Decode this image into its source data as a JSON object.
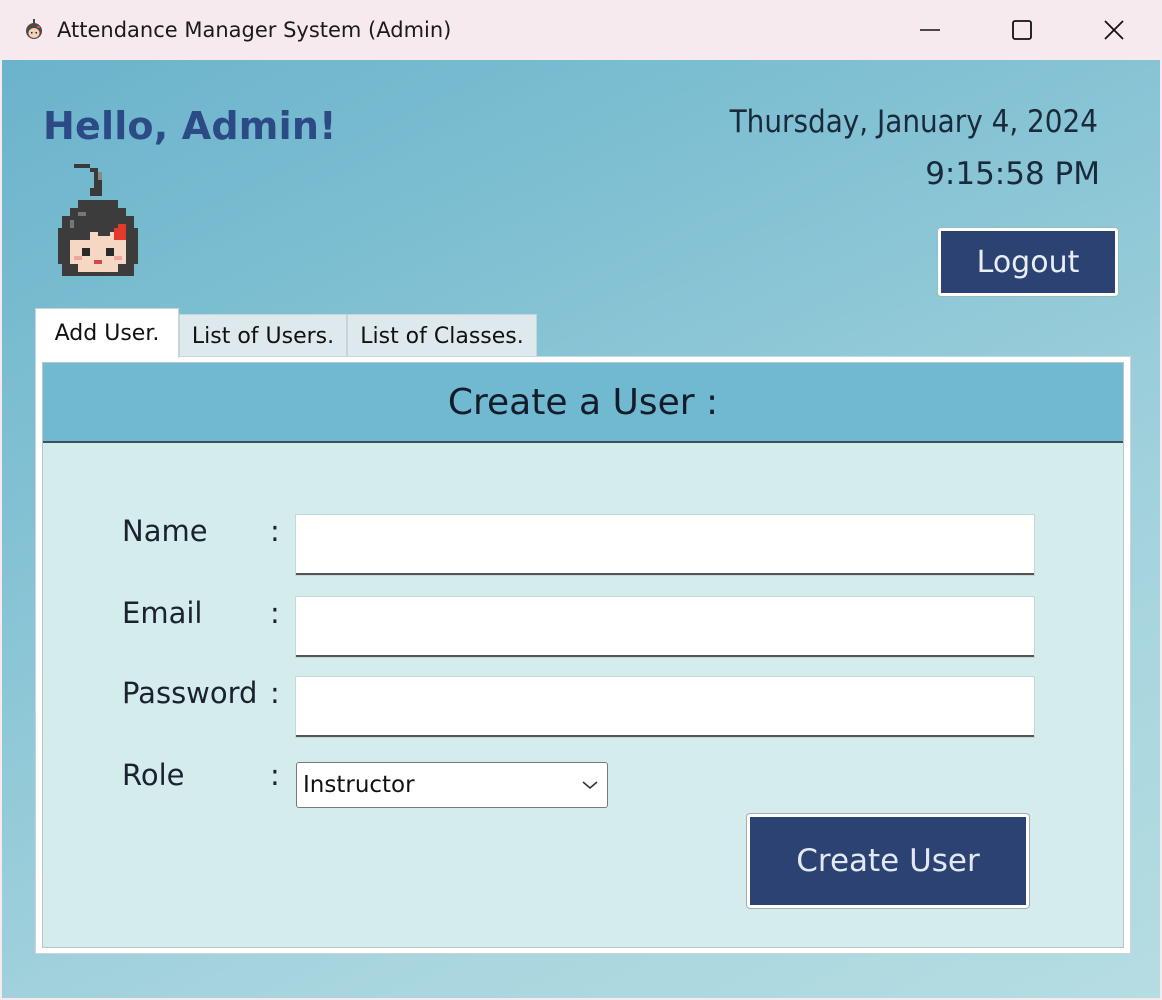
{
  "window": {
    "title": "Attendance Manager System (Admin)"
  },
  "header": {
    "greeting": "Hello, Admin!",
    "date": "Thursday, January 4, 2024",
    "time": "9:15:58 PM",
    "logout_label": "Logout"
  },
  "tabs": [
    {
      "label": "Add User.",
      "active": true
    },
    {
      "label": "List of Users.",
      "active": false
    },
    {
      "label": "List of Classes.",
      "active": false
    }
  ],
  "form": {
    "heading": "Create a User :",
    "name_label": "Name",
    "email_label": "Email",
    "password_label": "Password",
    "role_label": "Role",
    "colon": ":",
    "name_value": "",
    "email_value": "",
    "password_value": "",
    "role_value": "Instructor",
    "submit_label": "Create User"
  },
  "colors": {
    "accent": "#2c4272",
    "greeting": "#2b4a86",
    "header_band": "#70b9d0",
    "panel_bg": "#d5ecec"
  },
  "icons": {
    "app": "chibi-girl-icon",
    "avatar": "pixel-girl-avatar",
    "minimize": "minimize-icon",
    "maximize": "maximize-icon",
    "close": "close-icon",
    "dropdown": "chevron-down-icon"
  }
}
